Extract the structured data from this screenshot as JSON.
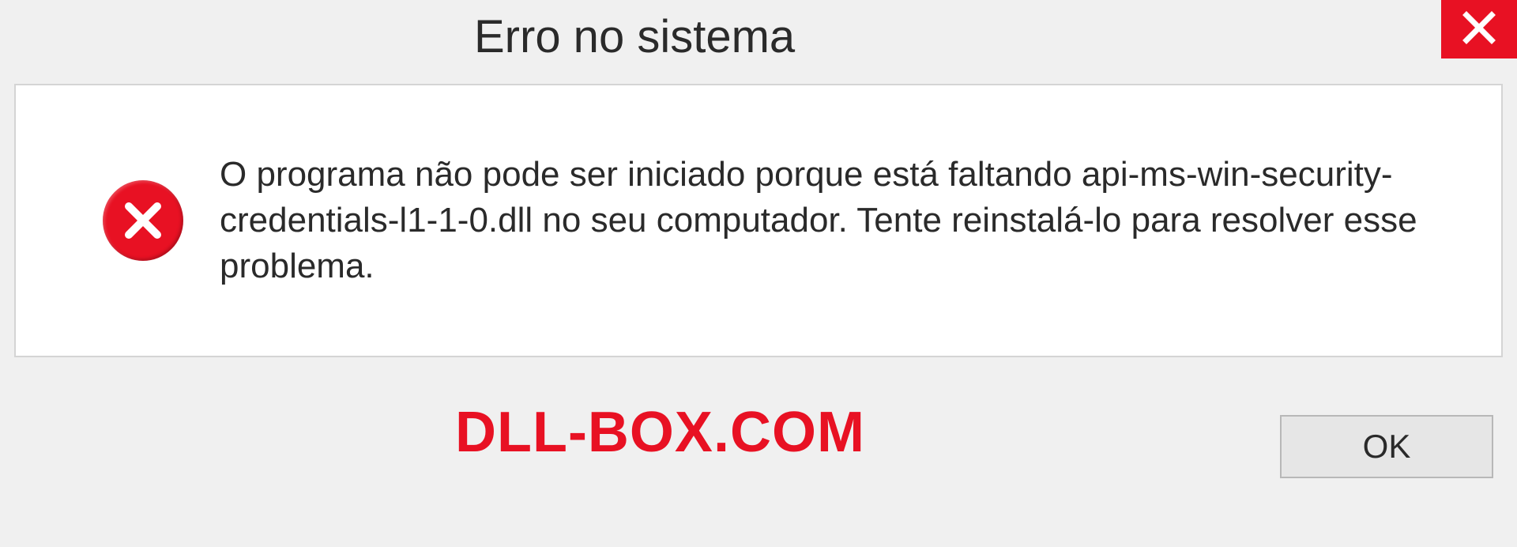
{
  "dialog": {
    "title": "Erro no sistema",
    "message": "O programa não pode ser iniciado porque está faltando api-ms-win-security-credentials-l1-1-0.dll no seu computador. Tente reinstalá-lo para resolver esse problema.",
    "ok_label": "OK"
  },
  "watermark": "DLL-BOX.COM"
}
